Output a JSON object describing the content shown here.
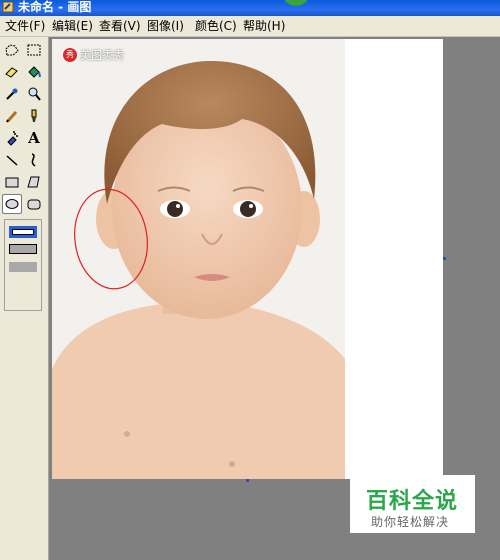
{
  "window": {
    "title": "未命名 - 画图"
  },
  "menu": {
    "items": [
      {
        "label": "文件(F)"
      },
      {
        "label": "编辑(E)"
      },
      {
        "label": "查看(V)"
      },
      {
        "label": "图像(I)"
      },
      {
        "label": "颜色(C)"
      },
      {
        "label": "帮助(H)"
      }
    ]
  },
  "toolbox": {
    "tools": [
      {
        "icon": "free-select-icon"
      },
      {
        "icon": "rect-select-icon"
      },
      {
        "icon": "eraser-icon"
      },
      {
        "icon": "fill-icon"
      },
      {
        "icon": "color-picker-icon"
      },
      {
        "icon": "magnifier-icon"
      },
      {
        "icon": "pencil-icon"
      },
      {
        "icon": "brush-icon"
      },
      {
        "icon": "airbrush-icon"
      },
      {
        "icon": "text-icon"
      },
      {
        "icon": "line-icon"
      },
      {
        "icon": "curve-icon"
      },
      {
        "icon": "rectangle-icon"
      },
      {
        "icon": "polygon-icon"
      },
      {
        "icon": "ellipse-icon"
      },
      {
        "icon": "rounded-rect-icon"
      }
    ],
    "selected_tool": "ellipse-icon",
    "text_tool_glyph": "A"
  },
  "canvas": {
    "watermark_badge": "秀",
    "watermark_text": "美图秀秀",
    "annotation_color": "#e02020"
  },
  "overlay": {
    "logo_main": "百科全说",
    "logo_sub": "助你轻松解决"
  },
  "colors": {
    "titlebar": "#0a5bdb",
    "workspace": "#808080",
    "chrome": "#ece9d8",
    "logo_green": "#2aa74a"
  }
}
